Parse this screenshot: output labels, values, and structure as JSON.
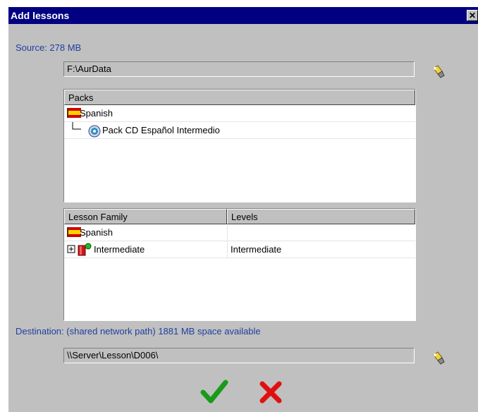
{
  "dialog": {
    "title": "Add lessons",
    "close_label": "✕"
  },
  "source": {
    "label": "Source: 278 MB",
    "path": "F:\\AurData",
    "browse_icon": "flashlight-icon"
  },
  "packs": {
    "header": "Packs",
    "rows": [
      {
        "label": "Spanish",
        "icon": "spain-flag-icon"
      },
      {
        "label": "Pack CD Español Intermedio",
        "icon": "cd-icon"
      }
    ]
  },
  "lessons": {
    "headers": {
      "family": "Lesson Family",
      "levels": "Levels"
    },
    "rows": [
      {
        "family": "Spanish",
        "levels": "",
        "icon": "spain-flag-icon"
      },
      {
        "family": "Intermediate",
        "levels": "Intermediate",
        "icon": "book-icon"
      }
    ]
  },
  "destination": {
    "label": "Destination: (shared network path) 1881 MB space available",
    "path": "\\\\Server\\Lesson\\D006\\",
    "browse_icon": "flashlight-icon"
  },
  "actions": {
    "ok_icon": "checkmark-icon",
    "cancel_icon": "red-x-icon"
  },
  "colors": {
    "title_bar": "#000080",
    "label_blue": "#1f3fa0",
    "dialog_bg": "#c0c0c0",
    "ok_green": "#1a9a1a",
    "cancel_red": "#e01010"
  }
}
